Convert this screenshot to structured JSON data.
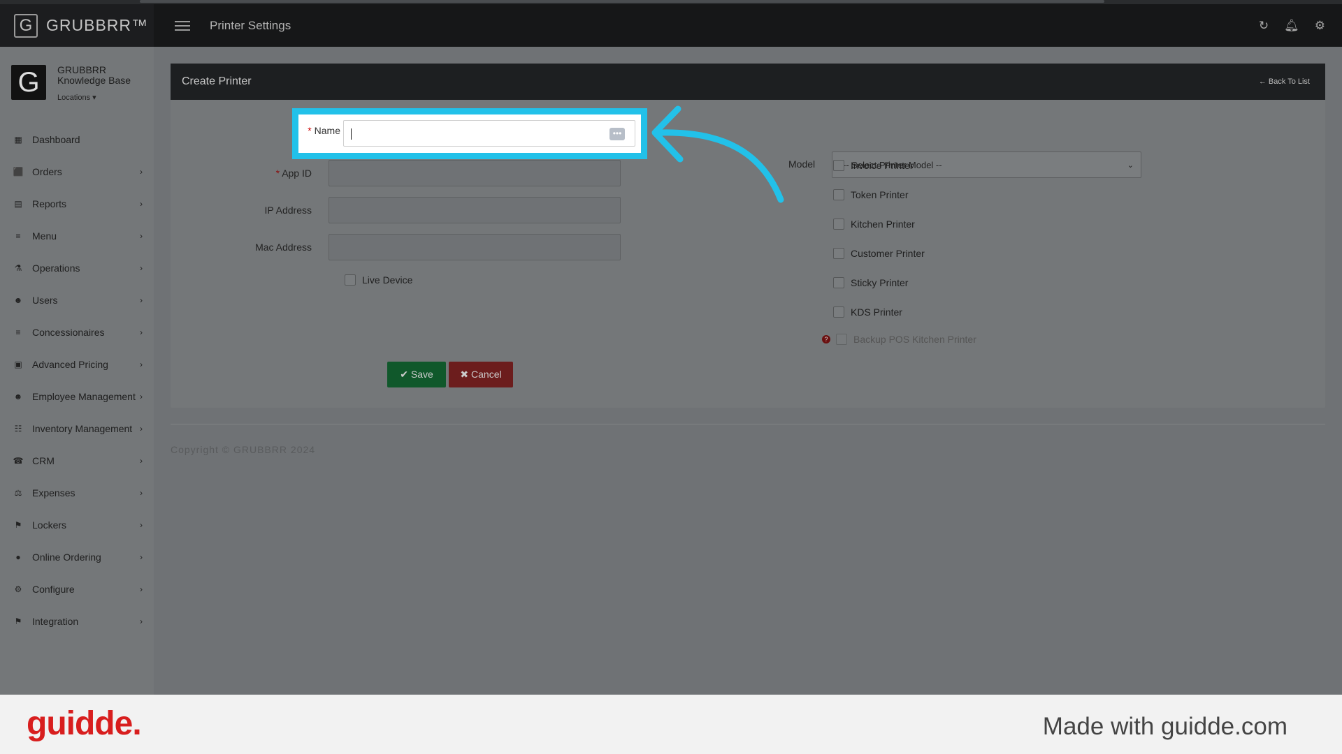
{
  "header": {
    "brand": "GRUBBRR™",
    "brand_icon": "G",
    "title": "Printer Settings",
    "icons": [
      "refresh-icon",
      "bell-icon",
      "gear-icon"
    ]
  },
  "profile": {
    "avatar": "G",
    "name_line1": "GRUBBRR",
    "name_line2": "Knowledge Base",
    "locations": "Locations ▾"
  },
  "sidebar": {
    "items": [
      {
        "label": "Dashboard",
        "icon": "▦",
        "chevron": ""
      },
      {
        "label": "Orders",
        "icon": "⬛",
        "chevron": "›"
      },
      {
        "label": "Reports",
        "icon": "▤",
        "chevron": "›"
      },
      {
        "label": "Menu",
        "icon": "≡",
        "chevron": "›"
      },
      {
        "label": "Operations",
        "icon": "⚗",
        "chevron": "›"
      },
      {
        "label": "Users",
        "icon": "☻",
        "chevron": "›"
      },
      {
        "label": "Concessionaires",
        "icon": "≡",
        "chevron": "›"
      },
      {
        "label": "Advanced Pricing",
        "icon": "▣",
        "chevron": "›"
      },
      {
        "label": "Employee Management",
        "icon": "☻",
        "chevron": "›"
      },
      {
        "label": "Inventory Management",
        "icon": "☷",
        "chevron": "›"
      },
      {
        "label": "CRM",
        "icon": "☎",
        "chevron": "›"
      },
      {
        "label": "Expenses",
        "icon": "⚖",
        "chevron": "›"
      },
      {
        "label": "Lockers",
        "icon": "⚑",
        "chevron": "›"
      },
      {
        "label": "Online Ordering",
        "icon": "●",
        "chevron": "›"
      },
      {
        "label": "Configure",
        "icon": "⚙",
        "chevron": "›"
      },
      {
        "label": "Integration",
        "icon": "⚑",
        "chevron": "›"
      }
    ]
  },
  "card": {
    "title": "Create Printer",
    "back": "← Back To List"
  },
  "form": {
    "name_label": "Name",
    "app_id_label": "App ID",
    "ip_label": "IP Address",
    "mac_label": "Mac Address",
    "live_device": "Live Device",
    "model_label": "Model",
    "model_placeholder": "-- Select Printer Model --",
    "printer_types": [
      "Invoice Printer",
      "Token Printer",
      "Kitchen Printer",
      "Customer Printer",
      "Sticky Printer",
      "KDS Printer"
    ],
    "backup_label": "Backup POS Kitchen Printer",
    "required_mark": "*",
    "save": "✔ Save",
    "cancel": "✖ Cancel"
  },
  "copyright": "Copyright © GRUBBRR 2024",
  "footer": {
    "logo": "guidde.",
    "made_with": "Made with guidde.com"
  },
  "colors": {
    "highlight": "#22c1e9",
    "save": "#10582b",
    "cancel": "#6c1d1d",
    "guidde": "#d81e1e"
  }
}
